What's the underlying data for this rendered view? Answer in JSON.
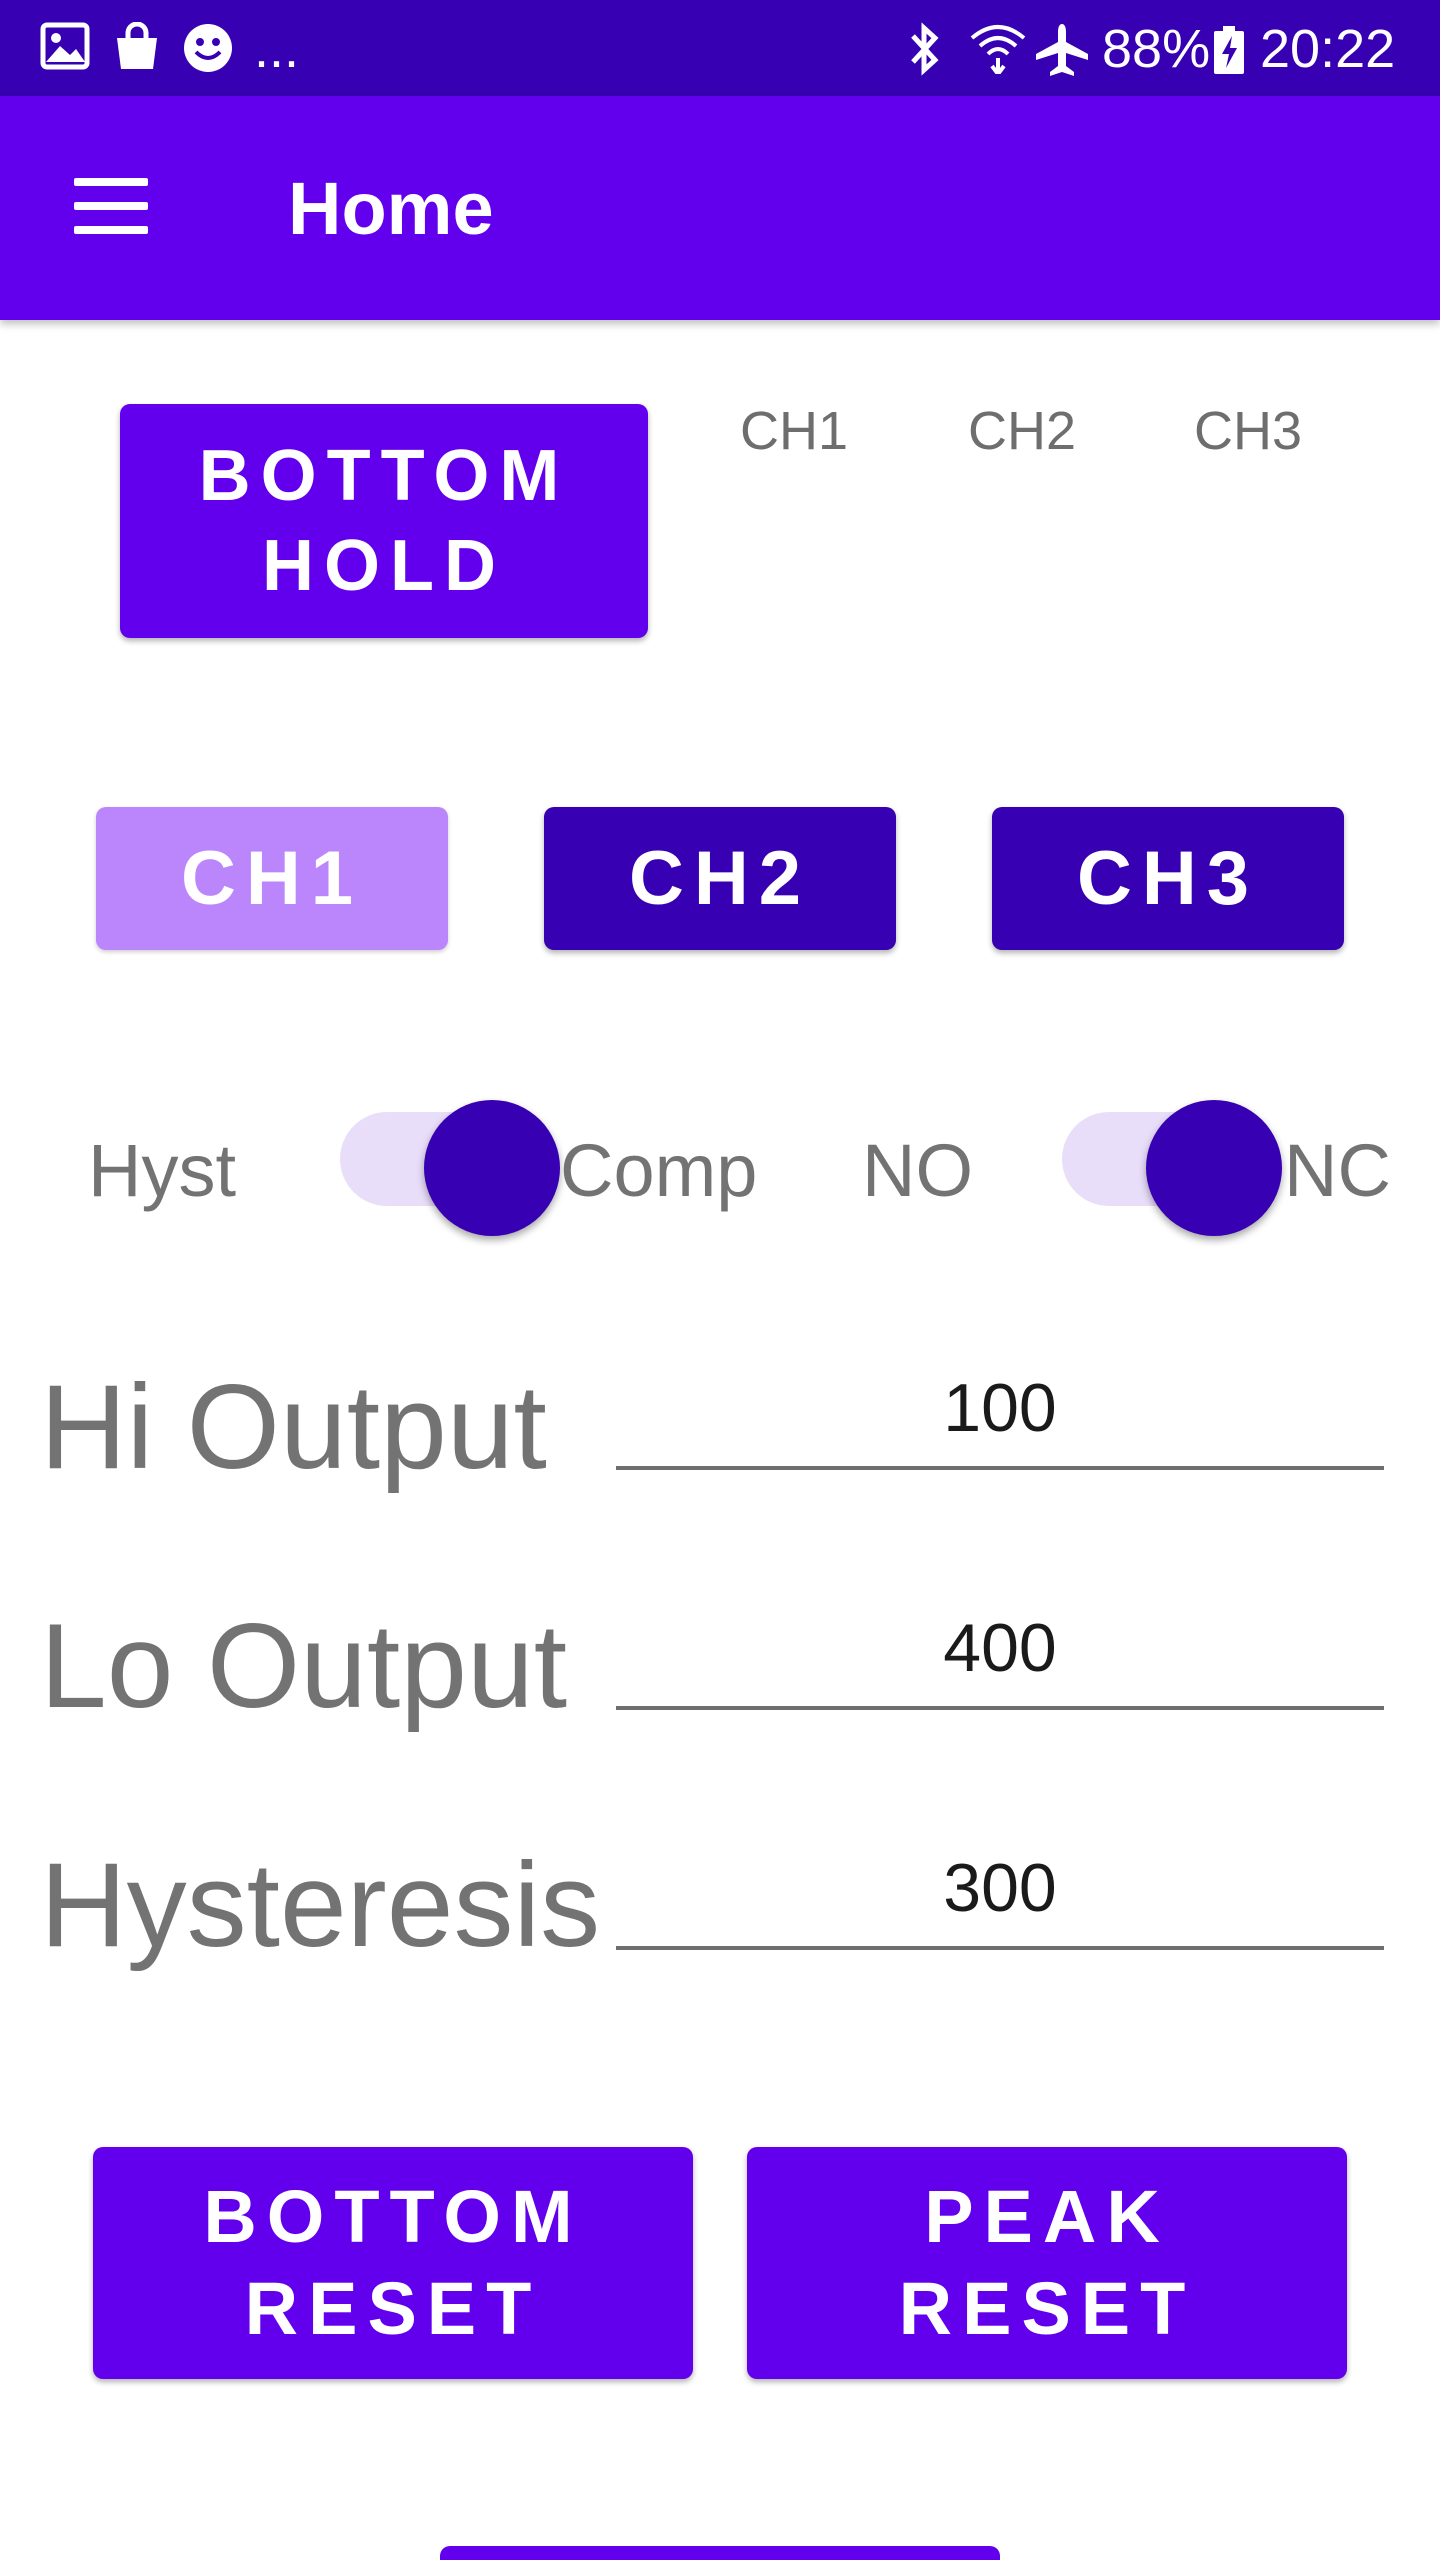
{
  "status_bar": {
    "battery": "88%",
    "time": "20:22",
    "more": "...",
    "icons": [
      "gallery-icon",
      "shopping-bag-icon",
      "smiley-icon",
      "bluetooth-icon",
      "wifi-icon",
      "airplane-icon",
      "battery-charging-icon"
    ]
  },
  "app_bar": {
    "title": "Home",
    "menu_icon": "hamburger-menu-icon"
  },
  "top": {
    "bottom_hold_label": "BOTTOM HOLD",
    "channel_labels": [
      "CH1",
      "CH2",
      "CH3"
    ]
  },
  "channel_buttons": [
    "CH1",
    "CH2",
    "CH3"
  ],
  "switches": {
    "left_off": "Hyst",
    "left_on": "Comp",
    "right_off": "NO",
    "right_on": "NC"
  },
  "fields": {
    "hi_output": {
      "label": "Hi Output",
      "value": "100"
    },
    "lo_output": {
      "label": "Lo Output",
      "value": "400"
    },
    "hysteresis": {
      "label": "Hysteresis",
      "value": "300"
    }
  },
  "actions": {
    "bottom_reset": "BOTTOM RESET",
    "peak_reset": "PEAK RESET"
  },
  "colors": {
    "status_bar": "#3700b3",
    "primary": "#6200ee",
    "primary_dark": "#3700b3",
    "disabled": "#bb86fc"
  }
}
